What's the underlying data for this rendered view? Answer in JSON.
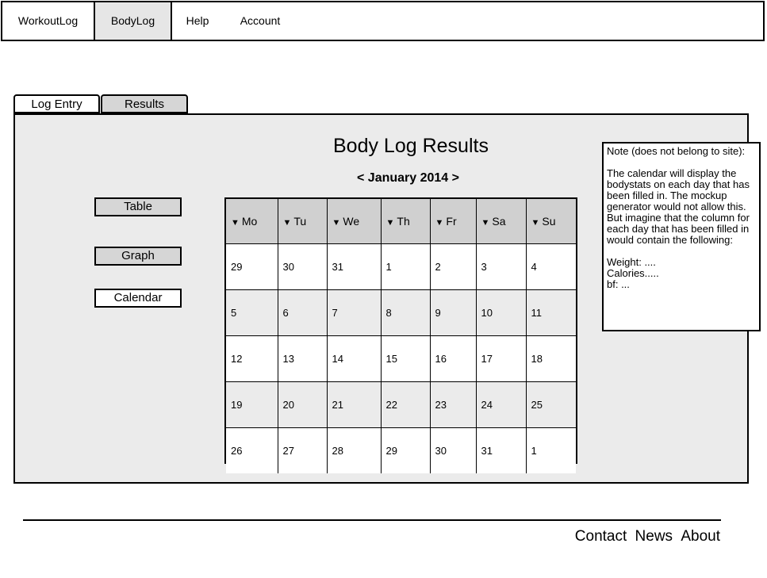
{
  "nav": {
    "items": [
      {
        "label": "WorkoutLog"
      },
      {
        "label": "BodyLog"
      },
      {
        "label": "Help"
      },
      {
        "label": "Account"
      }
    ],
    "active": "BodyLog"
  },
  "tabs": [
    {
      "label": "Log Entry"
    },
    {
      "label": "Results"
    }
  ],
  "main": {
    "title": "Body Log Results",
    "month_prev": "<",
    "month_label": "January 2014",
    "month_next": ">",
    "view_buttons": [
      {
        "label": "Table"
      },
      {
        "label": "Graph"
      },
      {
        "label": "Calendar"
      }
    ]
  },
  "calendar": {
    "headers": [
      "Mo",
      "Tu",
      "We",
      "Th",
      "Fr",
      "Sa",
      "Su"
    ],
    "weeks": [
      [
        "29",
        "30",
        "31",
        "1",
        "2",
        "3",
        "4"
      ],
      [
        "5",
        "6",
        "7",
        "8",
        "9",
        "10",
        "11"
      ],
      [
        "12",
        "13",
        "14",
        "15",
        "16",
        "17",
        "18"
      ],
      [
        "19",
        "20",
        "21",
        "22",
        "23",
        "24",
        "25"
      ],
      [
        "26",
        "27",
        "28",
        "29",
        "30",
        "31",
        "1"
      ]
    ]
  },
  "note": {
    "heading": "Note (does not belong to site):",
    "body": "The calendar will display the bodystats on each day that has been filled in. The mockup generator would not allow this. But imagine that the column for each day that has been filled in would contain the following:",
    "line1": "Weight: ....",
    "line2": "Calories.....",
    "line3": "bf: ..."
  },
  "footer": {
    "links": [
      "Contact",
      "News",
      "About"
    ]
  }
}
